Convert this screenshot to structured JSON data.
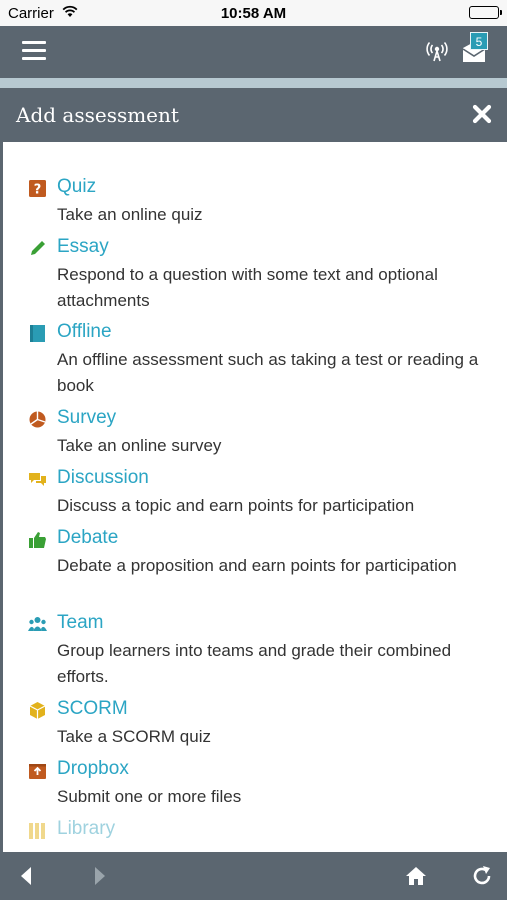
{
  "status_bar": {
    "carrier": "Carrier",
    "time": "10:58 AM"
  },
  "app_header": {
    "mail_badge_count": "5",
    "icons": [
      "menu-icon",
      "signal-icon",
      "mail-icon"
    ]
  },
  "modal": {
    "title": "Add assessment",
    "close_icon": "close-icon"
  },
  "assessments": [
    {
      "name": "Quiz",
      "description": "Take an online quiz",
      "icon": "quiz-icon",
      "color": "#c05a1f"
    },
    {
      "name": "Essay",
      "description": "Respond to a question with some text and optional attachments",
      "icon": "pencil-icon",
      "color": "#3aa035"
    },
    {
      "name": "Offline",
      "description": "An offline assessment such as taking a test or reading a book",
      "icon": "book-icon",
      "color": "#2a9cb4"
    },
    {
      "name": "Survey",
      "description": "Take an online survey",
      "icon": "pie-chart-icon",
      "color": "#c05a1f"
    },
    {
      "name": "Discussion",
      "description": "Discuss a topic and earn points for participation",
      "icon": "chat-icon",
      "color": "#e2b21c"
    },
    {
      "name": "Debate",
      "description": "Debate a proposition and earn points for participation",
      "icon": "thumbs-up-icon",
      "color": "#3aa035"
    },
    {
      "name": "Team",
      "description": "Group learners into teams and grade their combined efforts.",
      "icon": "team-icon",
      "color": "#2a9cb4"
    },
    {
      "name": "SCORM",
      "description": "Take a SCORM quiz",
      "icon": "cube-icon",
      "color": "#e2b21c"
    },
    {
      "name": "Dropbox",
      "description": "Submit one or more files",
      "icon": "inbox-icon",
      "color": "#c05a1f"
    },
    {
      "name": "Library",
      "description": "",
      "icon": "library-icon",
      "color": "#e2b21c"
    }
  ],
  "bottom_bar": {
    "icons": [
      "back-icon",
      "forward-icon",
      "home-icon",
      "refresh-icon"
    ]
  }
}
